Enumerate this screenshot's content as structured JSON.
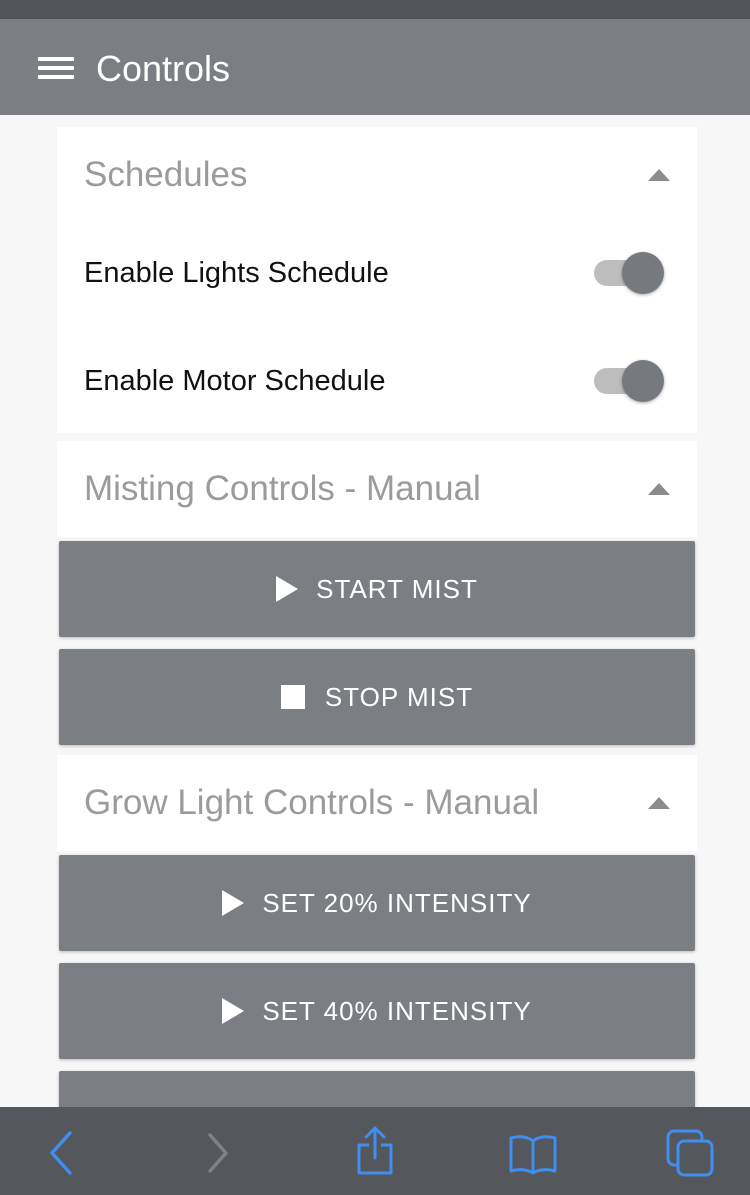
{
  "app_bar": {
    "title": "Controls",
    "menu_icon": "hamburger-menu-icon"
  },
  "sections": {
    "schedules": {
      "title": "Schedules",
      "expanded": true,
      "toggles": [
        {
          "label": "Enable Lights Schedule",
          "on": true
        },
        {
          "label": "Enable Motor Schedule",
          "on": true
        }
      ]
    },
    "misting": {
      "title": "Misting Controls - Manual",
      "expanded": true,
      "buttons": [
        {
          "label": "START MIST",
          "icon": "play-icon"
        },
        {
          "label": "STOP MIST",
          "icon": "stop-icon"
        }
      ]
    },
    "grow_light": {
      "title": "Grow Light Controls - Manual",
      "expanded": true,
      "buttons": [
        {
          "label": "SET 20% INTENSITY",
          "icon": "play-icon"
        },
        {
          "label": "SET 40% INTENSITY",
          "icon": "play-icon"
        }
      ]
    }
  },
  "browser_toolbar": {
    "items": [
      "back-icon",
      "forward-icon",
      "share-icon",
      "bookmarks-icon",
      "tabs-icon"
    ],
    "active_color": "#3f8ef0",
    "disabled_color": "#7e8186"
  },
  "colors": {
    "app_bar": "#7b7f83",
    "button": "#7b7f83",
    "section_title": "#9b9b9b",
    "switch_knob": "#767a7f"
  }
}
